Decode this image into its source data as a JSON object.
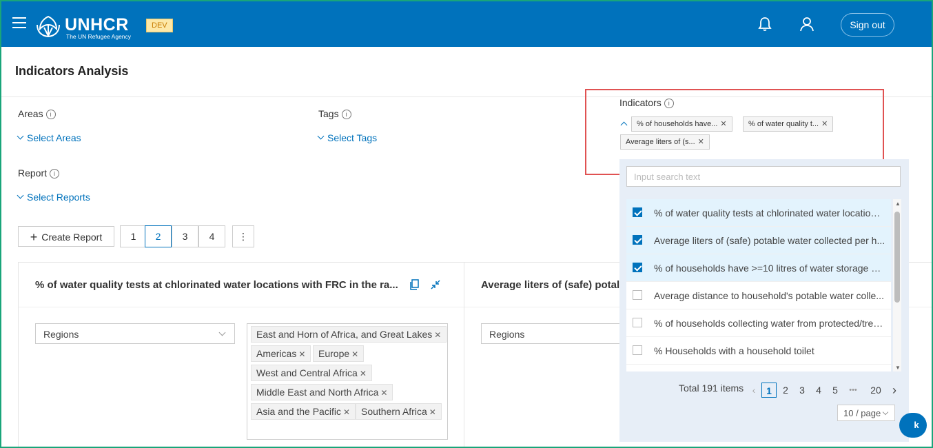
{
  "header": {
    "logo_text": "UNHCR",
    "logo_subtitle": "The UN Refugee Agency",
    "env_badge": "DEV",
    "signout_label": "Sign out",
    "icons": [
      "menu-icon",
      "bell-icon",
      "user-icon"
    ]
  },
  "page": {
    "title": "Indicators Analysis"
  },
  "filters": {
    "areas_label": "Areas",
    "areas_select": "Select Areas",
    "tags_label": "Tags",
    "tags_select": "Select Tags",
    "report_label": "Report",
    "report_select": "Select Reports",
    "indicators_label": "Indicators",
    "selected_indicators": [
      "% of households have...",
      "% of water quality t...",
      "Average liters of (s..."
    ]
  },
  "toolbar": {
    "create_report": "Create Report",
    "report_pages": [
      "1",
      "2",
      "3",
      "4"
    ],
    "active_page": "2",
    "more": "⋮"
  },
  "cards": [
    {
      "title": "% of water quality tests at chlorinated water locations with FRC in the ra...",
      "dropdown": "Regions",
      "regions": [
        "East and Horn of Africa, and Great Lakes",
        "Americas",
        "Europe",
        "West and Central Africa",
        "Middle East and North Africa",
        "Asia and the Pacific",
        "Southern Africa"
      ]
    },
    {
      "title": "Average liters of (safe) potal",
      "dropdown": "Regions"
    }
  ],
  "indicator_panel": {
    "search_placeholder": "Input search text",
    "items": [
      {
        "label": "% of water quality tests at chlorinated water locations...",
        "checked": true
      },
      {
        "label": "Average liters of (safe) potable water collected per h...",
        "checked": true
      },
      {
        "label": "% of households have >=10 litres of water storage ca...",
        "checked": true
      },
      {
        "label": "Average distance to household's potable water colle...",
        "checked": false
      },
      {
        "label": "% of households collecting water from protected/trea...",
        "checked": false
      },
      {
        "label": "% Households with a household toilet",
        "checked": false
      }
    ],
    "pagination": {
      "total": "Total 191 items",
      "prev": "‹",
      "next": "›",
      "pages": [
        "1",
        "2",
        "3",
        "4",
        "5",
        "•••",
        "20"
      ],
      "page_size": "10 / page"
    }
  },
  "feedback_label": "k",
  "colors": {
    "brand": "#0072bc",
    "highlight_box": "#e05252",
    "frame": "#1aa57a"
  }
}
